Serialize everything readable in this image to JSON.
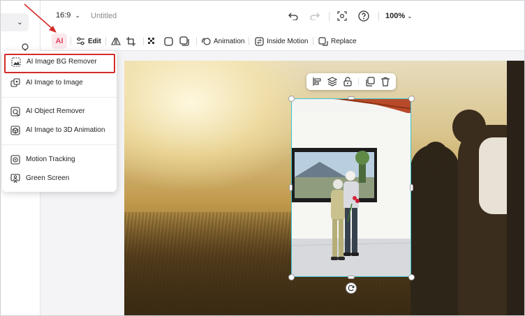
{
  "topbar": {
    "aspect_ratio": "16:9",
    "doc_title": "Untitled",
    "zoom": "100%"
  },
  "toolbar": {
    "ai_label": "AI",
    "edit_label": "Edit",
    "animation_label": "Animation",
    "inside_motion_label": "Inside Motion",
    "replace_label": "Replace"
  },
  "ai_menu": {
    "items": [
      {
        "label": "AI Image BG Remover",
        "icon": "bg-remover-icon"
      },
      {
        "label": "AI Image to Image",
        "icon": "image-to-image-icon"
      },
      {
        "label": "AI Object Remover",
        "icon": "object-remover-icon"
      },
      {
        "label": "AI Image to 3D Animation",
        "icon": "3d-animation-icon"
      },
      {
        "label": "Motion Tracking",
        "icon": "motion-tracking-icon"
      },
      {
        "label": "Green Screen",
        "icon": "green-screen-icon"
      }
    ],
    "highlighted_index": 0
  },
  "colors": {
    "accent_ai": "#e0415e",
    "selection": "#39c5cf",
    "annotation": "#d42a2a"
  }
}
